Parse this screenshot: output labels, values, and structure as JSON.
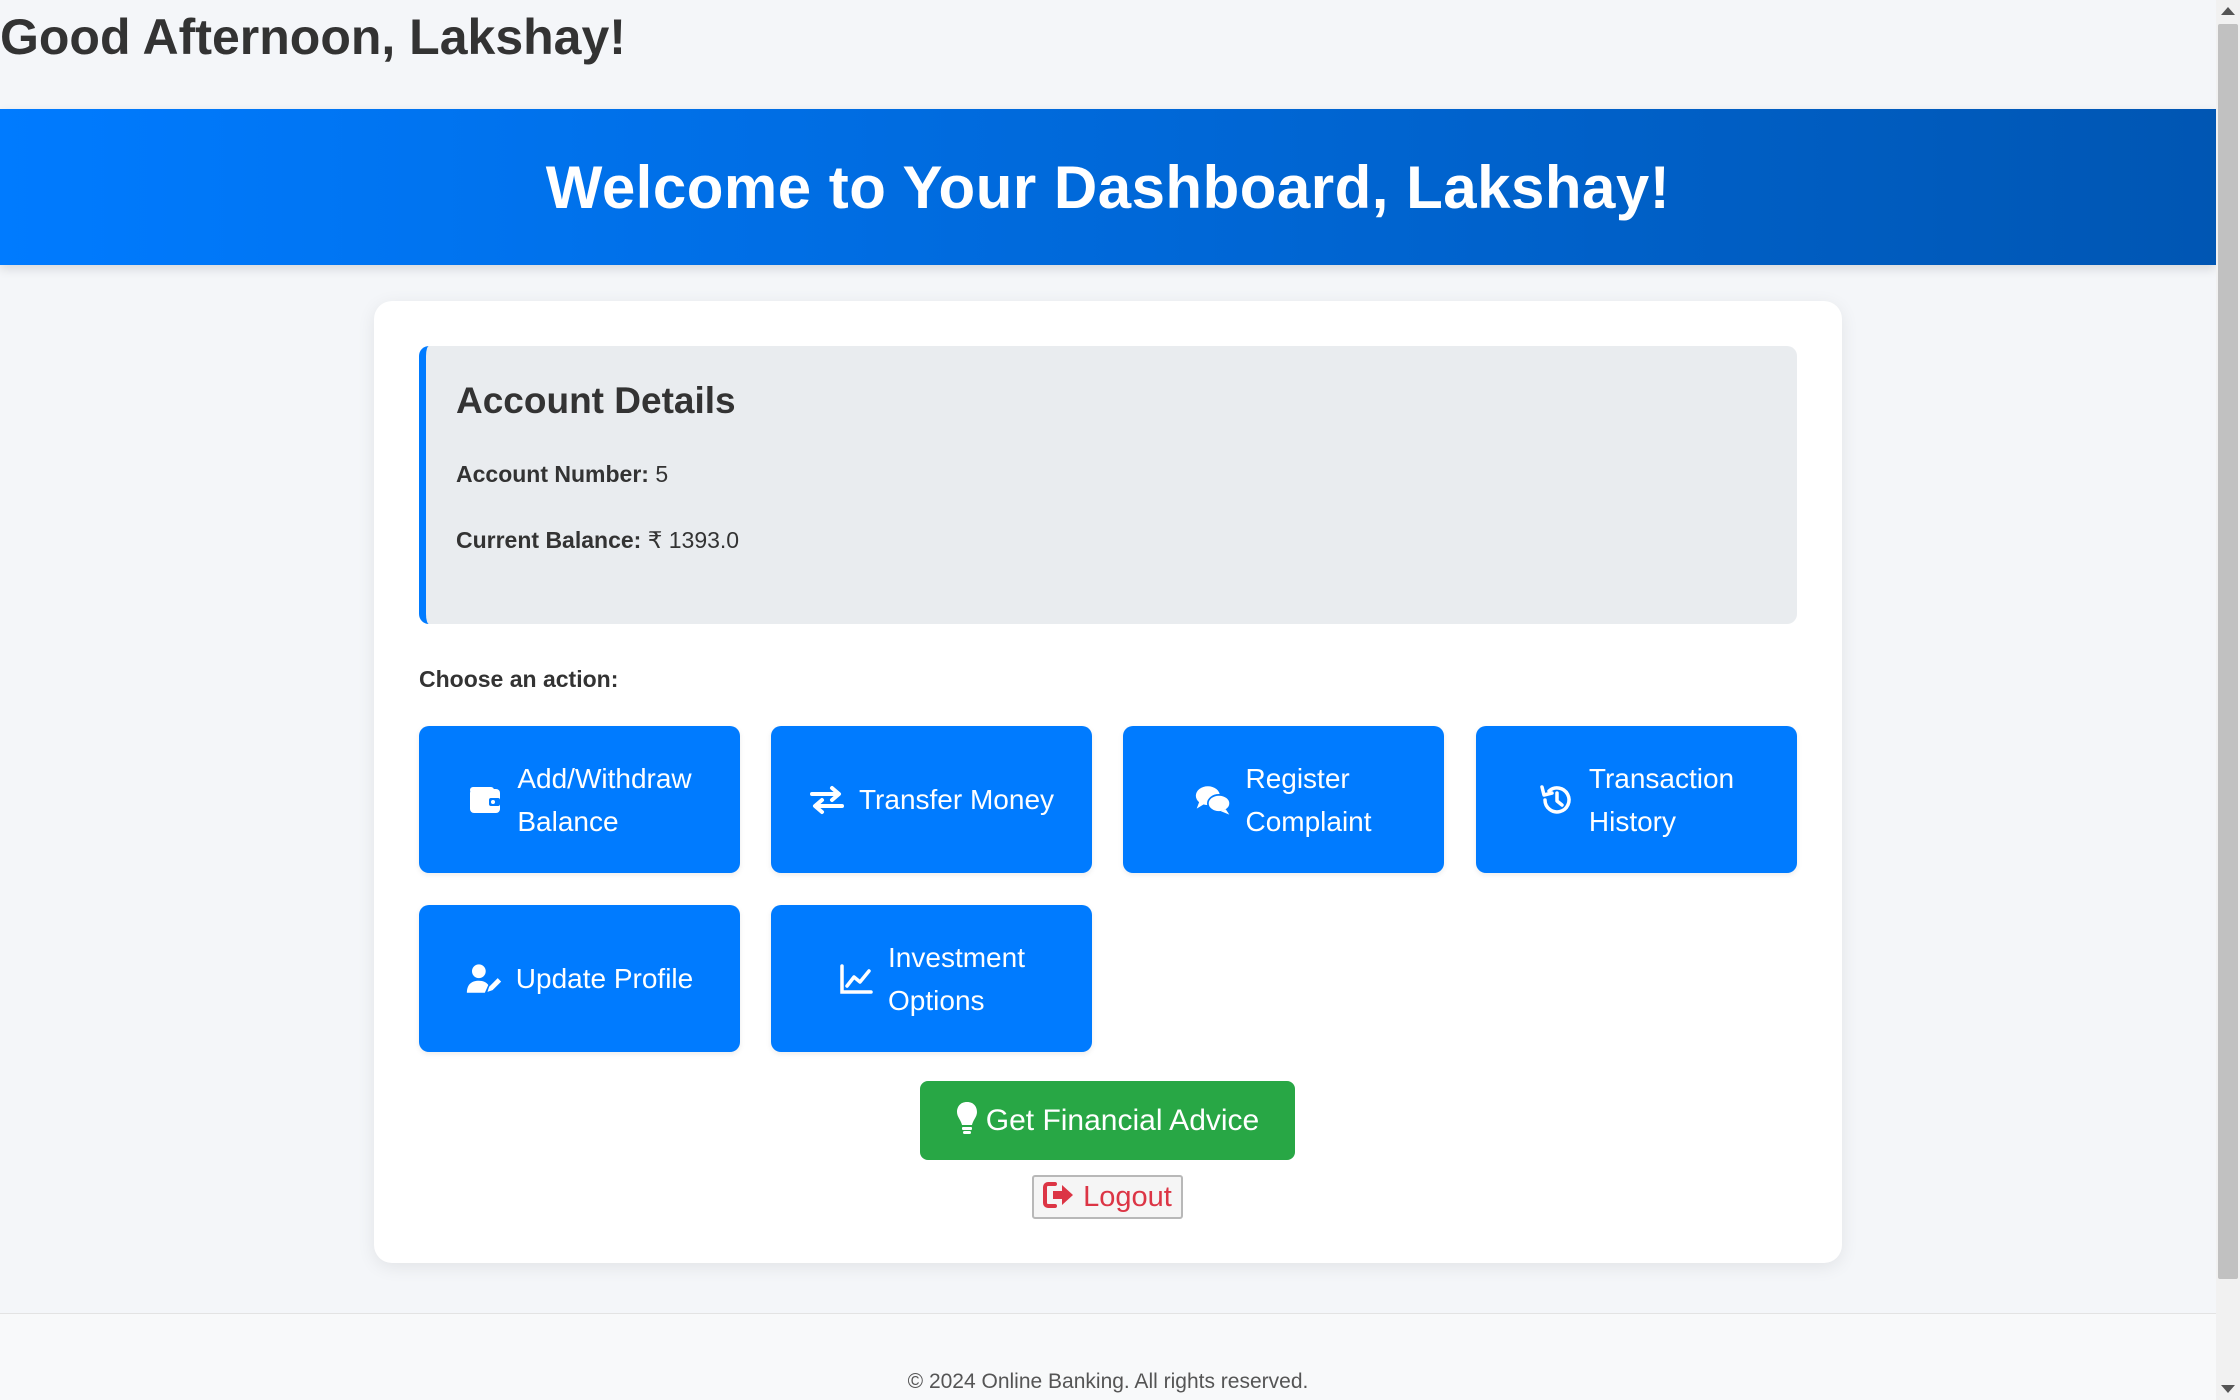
{
  "greeting": "Good Afternoon, Lakshay!",
  "banner": {
    "title": "Welcome to Your Dashboard, Lakshay!"
  },
  "account": {
    "heading": "Account Details",
    "number_label": "Account Number:",
    "number_value": " 5",
    "balance_label": "Current Balance:",
    "balance_value": " ₹ 1393.0"
  },
  "actions_heading": "Choose an action:",
  "actions": [
    {
      "label_line1": "Add/Withdraw",
      "label_line2": "Balance",
      "icon": "wallet-icon"
    },
    {
      "label_line1": "Transfer Money",
      "label_line2": "",
      "icon": "transfer-arrows-icon"
    },
    {
      "label_line1": "Register",
      "label_line2": "Complaint",
      "icon": "comments-icon"
    },
    {
      "label_line1": "Transaction",
      "label_line2": "History",
      "icon": "history-icon"
    },
    {
      "label_line1": "Update Profile",
      "label_line2": "",
      "icon": "user-edit-icon"
    },
    {
      "label_line1": "Investment",
      "label_line2": "Options",
      "icon": "chart-line-icon"
    }
  ],
  "advice_button": {
    "label": "Get Financial Advice",
    "icon": "lightbulb-icon"
  },
  "logout_button": {
    "label": "Logout",
    "icon": "sign-out-icon"
  },
  "footer": {
    "text": "© 2024 Online Banking. All rights reserved."
  },
  "colors": {
    "primary": "#007bff",
    "banner_end": "#0056b3",
    "success": "#28a745",
    "danger": "#dc3545"
  }
}
